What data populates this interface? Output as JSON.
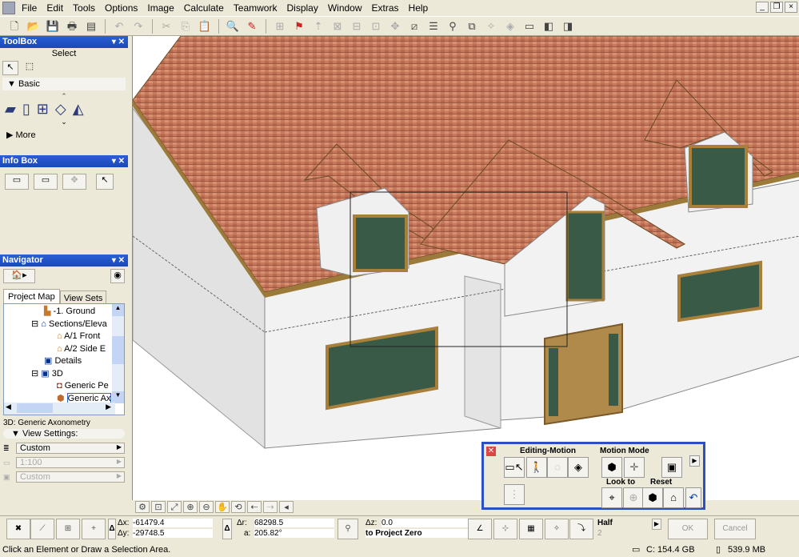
{
  "menu": [
    "File",
    "Edit",
    "Tools",
    "Options",
    "Image",
    "Calculate",
    "Teamwork",
    "Display",
    "Window",
    "Extras",
    "Help"
  ],
  "toolbox": {
    "title": "ToolBox",
    "select_label": "Select",
    "basic_label": "Basic",
    "more_label": "More"
  },
  "infobox": {
    "title": "Info Box"
  },
  "navigator": {
    "title": "Navigator",
    "tabs": [
      "Project Map",
      "View Sets"
    ],
    "tree": [
      "-1. Ground",
      "Sections/Eleva",
      "A/1 Front",
      "A/2 Side E",
      "Details",
      "3D",
      "Generic Pe",
      "Generic Ax"
    ],
    "view_name": "3D: Generic Axonometry",
    "view_settings_label": "View Settings:",
    "settings": [
      "Custom",
      "1:100",
      "Custom"
    ]
  },
  "motion": {
    "editing_label": "Editing-Motion",
    "mode_label": "Motion Mode",
    "look_label": "Look to",
    "reset_label": "Reset"
  },
  "coords": {
    "dx_label": "Δx:",
    "dx": "-61479.4",
    "dy_label": "Δy:",
    "dy": "-29748.5",
    "dr_label": "Δr:",
    "dr": "68298.5",
    "a_label": "a:",
    "a": "205.82°",
    "dz_label": "Δz:",
    "dz": "0.0",
    "ref": "to Project Zero",
    "gravity": "Half",
    "gravity_sub": "2",
    "ok": "OK",
    "cancel": "Cancel"
  },
  "status": {
    "message": "Click an Element or Draw a Selection Area.",
    "disk": "C: 154.4 GB",
    "memory": "539.9 MB"
  }
}
